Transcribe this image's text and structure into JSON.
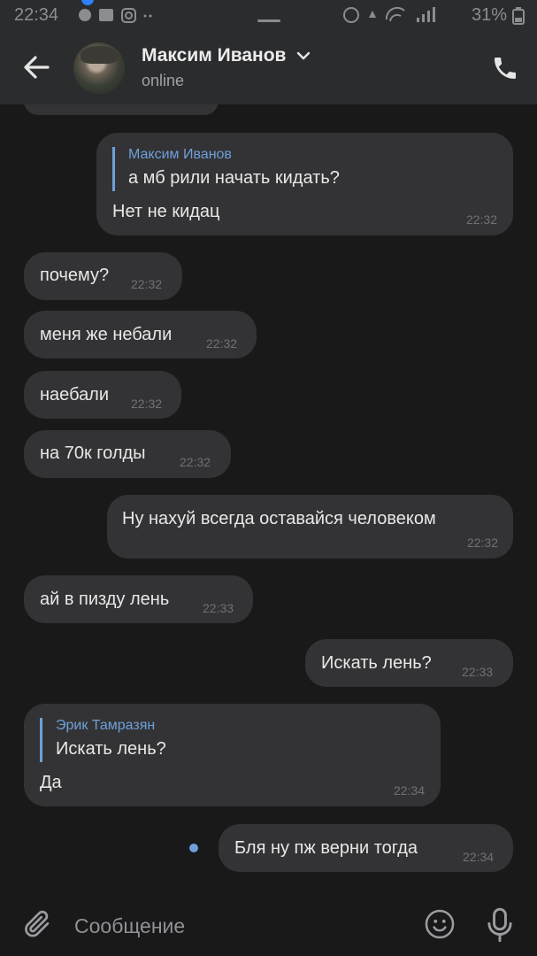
{
  "status_bar": {
    "time": "22:34",
    "battery": "31%"
  },
  "header": {
    "contact_name": "Максим Иванов",
    "status": "online"
  },
  "messages": [
    {
      "direction": "out",
      "reply_author": "Максим Иванов",
      "reply_text": "а мб рили начать кидать?",
      "text": "Нет не кидац",
      "time": "22:32"
    },
    {
      "direction": "in",
      "text": "почему?",
      "time": "22:32"
    },
    {
      "direction": "in",
      "text": "меня же небали",
      "time": "22:32"
    },
    {
      "direction": "in",
      "text": "наебали",
      "time": "22:32"
    },
    {
      "direction": "in",
      "text": "на 70к голды",
      "time": "22:32"
    },
    {
      "direction": "out",
      "text": "Ну нахуй всегда оставайся человеком",
      "time": "22:32"
    },
    {
      "direction": "in",
      "text": "ай в пизду лень",
      "time": "22:33"
    },
    {
      "direction": "out",
      "text": "Искать лень?",
      "time": "22:33"
    },
    {
      "direction": "in",
      "reply_author": "Эрик Тамразян",
      "reply_text": "Искать лень?",
      "text": "Да",
      "time": "22:34"
    },
    {
      "direction": "out",
      "text": "Бля ну пж верни тогда",
      "time": "22:34",
      "unread": true
    }
  ],
  "composer": {
    "placeholder": "Сообщение"
  },
  "colors": {
    "background": "#19191a",
    "header": "#2b2c2e",
    "bubble": "#333335",
    "accent": "#6ea0da"
  },
  "icons": {
    "back": "arrow-left-icon",
    "chevron": "chevron-down-icon",
    "call": "phone-icon",
    "attach": "paperclip-icon",
    "emoji": "smiley-icon",
    "mic": "microphone-icon"
  }
}
